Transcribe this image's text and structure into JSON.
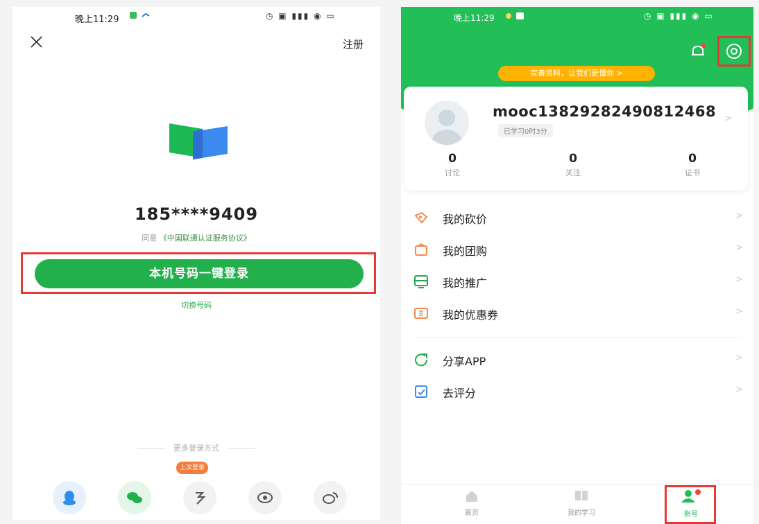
{
  "left": {
    "status_time": "晚上11:29",
    "register_label": "注册",
    "phone_number": "185****9409",
    "agreement_prefix": "同意",
    "agreement_link": "《中国联通认证服务协议》",
    "login_button": "本机号码一键登录",
    "switch_number": "切换号码",
    "more_login_label": "更多登录方式",
    "last_login_badge": "上次登录",
    "social_icons": [
      "qq-icon",
      "wechat-icon",
      "weiyi-icon",
      "camera-icon",
      "weibo-icon"
    ]
  },
  "right": {
    "status_time": "晚上11:29",
    "profile_prompt": "完善资料，让我们更懂你 >",
    "username": "mooc13829282490812468",
    "study_time": "已学习0时3分",
    "stats": [
      {
        "value": "0",
        "label": "讨论"
      },
      {
        "value": "0",
        "label": "关注"
      },
      {
        "value": "0",
        "label": "证书"
      }
    ],
    "menu": [
      {
        "label": "我的砍价",
        "icon": "bargain-icon"
      },
      {
        "label": "我的团购",
        "icon": "group-buy-icon"
      },
      {
        "label": "我的推广",
        "icon": "promotion-icon"
      },
      {
        "label": "我的优惠券",
        "icon": "coupon-icon"
      },
      {
        "label": "分享APP",
        "icon": "share-icon"
      },
      {
        "label": "去评分",
        "icon": "rate-icon"
      }
    ],
    "tabs": [
      {
        "label": "首页",
        "icon": "home-icon"
      },
      {
        "label": "我的学习",
        "icon": "my-learning-icon"
      },
      {
        "label": "账号",
        "icon": "account-icon"
      }
    ],
    "chevron": ">"
  },
  "colors": {
    "brand_green": "#22be58",
    "highlight_red": "#e53935",
    "pill_orange": "#ffb300"
  }
}
